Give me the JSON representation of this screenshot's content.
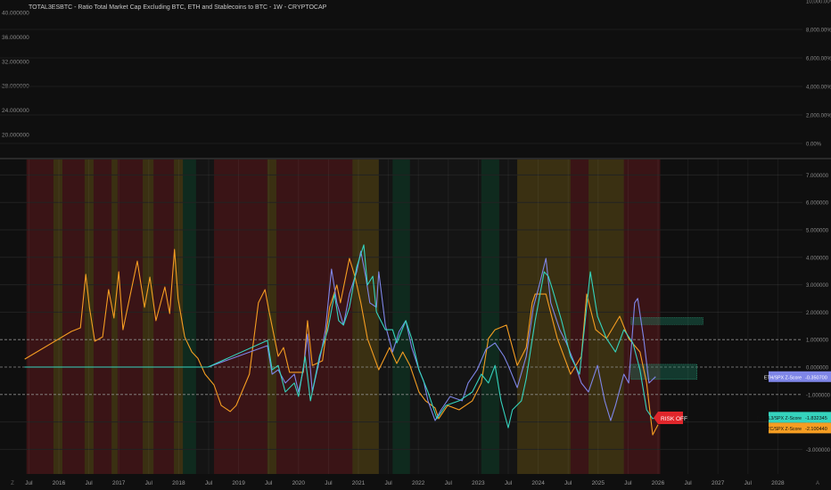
{
  "header": {
    "title": "TOTAL3ESBTC - Ratio Total Market Cap Excluding BTC, ETH and Stablecoins to BTC - 1W - CRYPTOCAP"
  },
  "top_pane": {
    "left_axis_labels": [
      "40.000000",
      "36.000000",
      "32.000000",
      "28.000000",
      "24.000000",
      "20.000000"
    ],
    "left_axis_values": [
      40,
      36,
      32,
      28,
      24,
      20
    ],
    "right_axis_labels": [
      "10,000.00%",
      "8,000.00%",
      "6,000.00%",
      "4,000.00%",
      "2,000.00%",
      "0.00%"
    ],
    "right_axis_values": [
      10000,
      8000,
      6000,
      4000,
      2000,
      0
    ]
  },
  "time_axis": {
    "labels": [
      "Jul",
      "2016",
      "Jul",
      "2017",
      "Jul",
      "2018",
      "Jul",
      "2019",
      "Jul",
      "2020",
      "Jul",
      "2021",
      "Jul",
      "2022",
      "Jul",
      "2023",
      "Jul",
      "2024",
      "Jul",
      "2025",
      "Jul",
      "2026",
      "Jul",
      "2027",
      "Jul",
      "2028"
    ],
    "values": [
      2015.5,
      2016,
      2016.5,
      2017,
      2017.5,
      2018,
      2018.5,
      2019,
      2019.5,
      2020,
      2020.5,
      2021,
      2021.5,
      2022,
      2022.5,
      2023,
      2023.5,
      2024,
      2024.5,
      2025,
      2025.5,
      2026,
      2026.5,
      2027,
      2027.5,
      2028
    ],
    "left_button": "Z",
    "right_button": "A"
  },
  "colors": {
    "btc": "#f59d22",
    "eth": "#7f86e8",
    "total3": "#35d3bd",
    "risk_off": "#e0262b",
    "regime_red": "#3a1416",
    "regime_yellow": "#3a3012",
    "regime_green": "#0f2a1e",
    "regime_dark": "#141414"
  },
  "chart_data": {
    "type": "line",
    "title": "Z-Score vs SPX",
    "xlabel": "",
    "ylabel": "Z-Score",
    "xlim": [
      2015.3,
      2028.4
    ],
    "ylim": [
      -3.5,
      7.5
    ],
    "y_ticks": [
      7,
      6,
      5,
      4,
      3,
      2,
      1,
      0,
      -1,
      -2,
      -3
    ],
    "y_tick_labels": [
      "7.000000",
      "6.000000",
      "5.000000",
      "4.000000",
      "3.000000",
      "2.000000",
      "1.000000",
      "0.000000",
      "-1.000000",
      "-2.000000",
      "-3.000000"
    ],
    "reference_lines": [
      1,
      0,
      -1
    ],
    "signal_label": "RISK OFF",
    "regimes": [
      [
        2015.46,
        2015.91,
        "red"
      ],
      [
        2015.91,
        2016.06,
        "yellow"
      ],
      [
        2016.06,
        2016.43,
        "red"
      ],
      [
        2016.43,
        2016.58,
        "yellow"
      ],
      [
        2016.58,
        2016.88,
        "red"
      ],
      [
        2016.88,
        2016.98,
        "yellow"
      ],
      [
        2016.98,
        2017.4,
        "red"
      ],
      [
        2017.4,
        2017.58,
        "yellow"
      ],
      [
        2017.58,
        2017.92,
        "red"
      ],
      [
        2017.92,
        2018.07,
        "yellow"
      ],
      [
        2018.07,
        2018.29,
        "green"
      ],
      [
        2018.29,
        2018.59,
        "dark"
      ],
      [
        2018.59,
        2019.48,
        "red"
      ],
      [
        2019.48,
        2019.63,
        "yellow"
      ],
      [
        2019.63,
        2020.9,
        "red"
      ],
      [
        2020.9,
        2021.34,
        "yellow"
      ],
      [
        2021.34,
        2021.57,
        "dark"
      ],
      [
        2021.57,
        2021.86,
        "green"
      ],
      [
        2021.86,
        2023.05,
        "dark"
      ],
      [
        2023.05,
        2023.35,
        "green"
      ],
      [
        2023.35,
        2023.65,
        "dark"
      ],
      [
        2023.65,
        2024.54,
        "yellow"
      ],
      [
        2024.54,
        2024.84,
        "red"
      ],
      [
        2024.84,
        2025.43,
        "yellow"
      ],
      [
        2025.43,
        2026.03,
        "red"
      ]
    ],
    "series": [
      {
        "name": "BTC/SPX Z-Score",
        "key": "btc",
        "last_label": "-2.100440",
        "points": [
          [
            2015.43,
            0.29
          ],
          [
            2016.21,
            1.3
          ],
          [
            2016.36,
            1.43
          ],
          [
            2016.45,
            3.38
          ],
          [
            2016.51,
            2.18
          ],
          [
            2016.6,
            0.94
          ],
          [
            2016.73,
            1.1
          ],
          [
            2016.83,
            2.82
          ],
          [
            2016.92,
            1.79
          ],
          [
            2017.0,
            3.47
          ],
          [
            2017.07,
            1.36
          ],
          [
            2017.31,
            3.86
          ],
          [
            2017.43,
            2.18
          ],
          [
            2017.52,
            3.28
          ],
          [
            2017.62,
            1.69
          ],
          [
            2017.77,
            2.92
          ],
          [
            2017.85,
            1.95
          ],
          [
            2017.93,
            4.29
          ],
          [
            2017.99,
            2.5
          ],
          [
            2018.1,
            1.1
          ],
          [
            2018.22,
            0.55
          ],
          [
            2018.32,
            0.32
          ],
          [
            2018.44,
            -0.26
          ],
          [
            2018.59,
            -0.65
          ],
          [
            2018.71,
            -1.4
          ],
          [
            2018.86,
            -1.62
          ],
          [
            2018.96,
            -1.4
          ],
          [
            2019.18,
            -0.26
          ],
          [
            2019.33,
            2.34
          ],
          [
            2019.44,
            2.82
          ],
          [
            2019.51,
            2.01
          ],
          [
            2019.66,
            0.39
          ],
          [
            2019.75,
            0.71
          ],
          [
            2019.85,
            -0.19
          ],
          [
            2020.08,
            -0.19
          ],
          [
            2020.15,
            1.69
          ],
          [
            2020.23,
            0.06
          ],
          [
            2020.4,
            0.23
          ],
          [
            2020.52,
            2.18
          ],
          [
            2020.64,
            2.99
          ],
          [
            2020.7,
            2.34
          ],
          [
            2020.85,
            3.96
          ],
          [
            2020.94,
            3.31
          ],
          [
            2021.04,
            2.34
          ],
          [
            2021.15,
            1.04
          ],
          [
            2021.34,
            -0.1
          ],
          [
            2021.52,
            0.71
          ],
          [
            2021.64,
            0.13
          ],
          [
            2021.74,
            0.55
          ],
          [
            2021.86,
            0.06
          ],
          [
            2022.01,
            -0.91
          ],
          [
            2022.12,
            -1.23
          ],
          [
            2022.28,
            -1.49
          ],
          [
            2022.34,
            -1.88
          ],
          [
            2022.49,
            -1.4
          ],
          [
            2022.68,
            -1.56
          ],
          [
            2022.9,
            -1.23
          ],
          [
            2023.05,
            -0.58
          ],
          [
            2023.17,
            1.04
          ],
          [
            2023.28,
            1.36
          ],
          [
            2023.47,
            1.53
          ],
          [
            2023.65,
            0.06
          ],
          [
            2023.8,
            0.71
          ],
          [
            2023.9,
            2.34
          ],
          [
            2023.95,
            2.66
          ],
          [
            2024.13,
            2.66
          ],
          [
            2024.32,
            1.04
          ],
          [
            2024.54,
            -0.26
          ],
          [
            2024.72,
            0.39
          ],
          [
            2024.81,
            2.66
          ],
          [
            2024.96,
            1.36
          ],
          [
            2025.14,
            1.04
          ],
          [
            2025.36,
            1.85
          ],
          [
            2025.51,
            1.04
          ],
          [
            2025.7,
            0.55
          ],
          [
            2025.81,
            -0.58
          ],
          [
            2025.91,
            -2.47
          ],
          [
            2026.0,
            -2.1
          ]
        ]
      },
      {
        "name": "ETH/SPX Z-Score",
        "key": "eth",
        "last_label": "-0.350700",
        "points": [
          [
            2015.43,
            0
          ],
          [
            2018.49,
            0
          ],
          [
            2019.48,
            0.78
          ],
          [
            2019.56,
            -0.26
          ],
          [
            2019.66,
            -0.1
          ],
          [
            2019.78,
            -0.58
          ],
          [
            2019.93,
            -0.26
          ],
          [
            2020.0,
            -0.91
          ],
          [
            2020.08,
            -0.1
          ],
          [
            2020.15,
            1.2
          ],
          [
            2020.23,
            -0.91
          ],
          [
            2020.38,
            0.55
          ],
          [
            2020.45,
            1.36
          ],
          [
            2020.55,
            3.57
          ],
          [
            2020.64,
            2.34
          ],
          [
            2020.75,
            1.53
          ],
          [
            2020.85,
            2.66
          ],
          [
            2020.97,
            3.47
          ],
          [
            2021.04,
            4.22
          ],
          [
            2021.12,
            3.31
          ],
          [
            2021.19,
            2.34
          ],
          [
            2021.3,
            2.18
          ],
          [
            2021.34,
            3.47
          ],
          [
            2021.45,
            1.53
          ],
          [
            2021.57,
            0.55
          ],
          [
            2021.68,
            1.3
          ],
          [
            2021.79,
            1.69
          ],
          [
            2021.89,
            0.71
          ],
          [
            2022.01,
            -0.1
          ],
          [
            2022.09,
            -0.52
          ],
          [
            2022.16,
            -1.23
          ],
          [
            2022.28,
            -1.95
          ],
          [
            2022.38,
            -1.56
          ],
          [
            2022.53,
            -1.07
          ],
          [
            2022.73,
            -1.23
          ],
          [
            2022.83,
            -0.58
          ],
          [
            2022.98,
            -0.1
          ],
          [
            2023.13,
            0.65
          ],
          [
            2023.28,
            0.88
          ],
          [
            2023.43,
            0.39
          ],
          [
            2023.5,
            0.06
          ],
          [
            2023.65,
            -0.75
          ],
          [
            2023.8,
            0.39
          ],
          [
            2023.92,
            2.18
          ],
          [
            2024.02,
            2.99
          ],
          [
            2024.13,
            3.96
          ],
          [
            2024.21,
            2.34
          ],
          [
            2024.36,
            1.36
          ],
          [
            2024.47,
            0.88
          ],
          [
            2024.62,
            0.06
          ],
          [
            2024.72,
            -0.58
          ],
          [
            2024.84,
            -0.91
          ],
          [
            2024.99,
            0.06
          ],
          [
            2025.11,
            -1.23
          ],
          [
            2025.21,
            -1.95
          ],
          [
            2025.29,
            -1.4
          ],
          [
            2025.43,
            -0.26
          ],
          [
            2025.51,
            -0.58
          ],
          [
            2025.61,
            2.34
          ],
          [
            2025.66,
            2.5
          ],
          [
            2025.76,
            1.04
          ],
          [
            2025.85,
            -0.58
          ],
          [
            2025.96,
            -0.35
          ]
        ]
      },
      {
        "name": "TOTAL3/SPX Z-Score",
        "key": "total3",
        "last_label": "-1.832345",
        "points": [
          [
            2015.43,
            0
          ],
          [
            2018.49,
            0
          ],
          [
            2019.48,
            0.97
          ],
          [
            2019.56,
            -0.1
          ],
          [
            2019.66,
            0.06
          ],
          [
            2019.78,
            -0.91
          ],
          [
            2019.93,
            -0.58
          ],
          [
            2020.0,
            -1.07
          ],
          [
            2020.11,
            0.39
          ],
          [
            2020.2,
            -1.23
          ],
          [
            2020.35,
            0.39
          ],
          [
            2020.49,
            1.36
          ],
          [
            2020.6,
            2.66
          ],
          [
            2020.67,
            1.69
          ],
          [
            2020.75,
            1.53
          ],
          [
            2020.85,
            2.18
          ],
          [
            2020.97,
            3.64
          ],
          [
            2021.09,
            4.45
          ],
          [
            2021.15,
            2.99
          ],
          [
            2021.24,
            3.31
          ],
          [
            2021.3,
            2.01
          ],
          [
            2021.45,
            1.36
          ],
          [
            2021.57,
            1.36
          ],
          [
            2021.64,
            0.88
          ],
          [
            2021.79,
            1.69
          ],
          [
            2021.89,
            1.04
          ],
          [
            2022.01,
            -0.1
          ],
          [
            2022.16,
            -0.91
          ],
          [
            2022.31,
            -1.88
          ],
          [
            2022.46,
            -1.4
          ],
          [
            2022.68,
            -1.23
          ],
          [
            2022.9,
            -0.91
          ],
          [
            2023.05,
            -0.26
          ],
          [
            2023.17,
            -0.58
          ],
          [
            2023.28,
            0.06
          ],
          [
            2023.38,
            -1.23
          ],
          [
            2023.5,
            -2.21
          ],
          [
            2023.57,
            -1.56
          ],
          [
            2023.72,
            -1.23
          ],
          [
            2023.8,
            -0.42
          ],
          [
            2023.95,
            1.69
          ],
          [
            2024.1,
            3.47
          ],
          [
            2024.17,
            3.31
          ],
          [
            2024.24,
            2.82
          ],
          [
            2024.39,
            1.69
          ],
          [
            2024.54,
            0.39
          ],
          [
            2024.69,
            -0.26
          ],
          [
            2024.87,
            3.47
          ],
          [
            2024.99,
            1.85
          ],
          [
            2025.14,
            1.04
          ],
          [
            2025.29,
            0.55
          ],
          [
            2025.43,
            1.36
          ],
          [
            2025.58,
            0.88
          ],
          [
            2025.7,
            -0.1
          ],
          [
            2025.81,
            -1.56
          ],
          [
            2025.91,
            -1.88
          ],
          [
            2026.0,
            -1.83
          ]
        ]
      }
    ],
    "zones": [
      [
        2025.55,
        2026.75,
        1.55,
        1.8
      ],
      [
        2025.55,
        2026.65,
        -0.45,
        0.1
      ]
    ]
  }
}
